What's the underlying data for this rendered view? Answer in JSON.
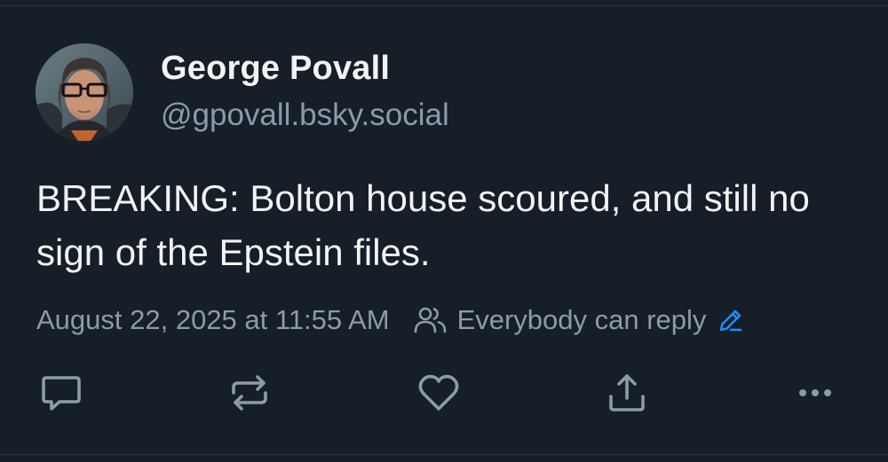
{
  "author": {
    "display_name": "George Povall",
    "handle": "@gpovall.bsky.social"
  },
  "post": {
    "text": "BREAKING: Bolton house scoured, and still no sign of the Epstein files.",
    "timestamp": "August 22, 2025 at 11:55 AM",
    "reply_setting": "Everybody can reply"
  },
  "icons": {
    "reply": "speech-bubble-icon",
    "repost": "repost-arrows-icon",
    "like": "heart-icon",
    "share": "share-upload-icon",
    "more": "more-dots-icon",
    "audience": "people-icon",
    "edit": "pencil-icon"
  },
  "colors": {
    "background": "#161e27",
    "text_primary": "#f1f3f5",
    "text_secondary": "#8d9aab",
    "accent": "#208bfe"
  }
}
